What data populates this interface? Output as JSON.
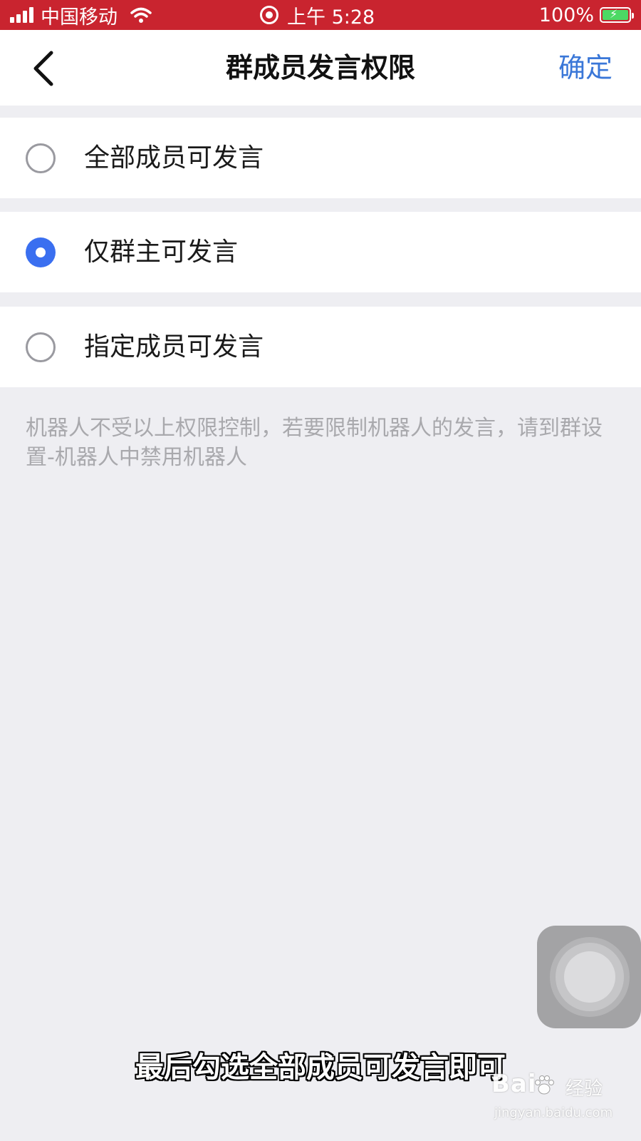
{
  "status_bar": {
    "carrier": "中国移动",
    "time": "上午 5:28",
    "battery": "100%",
    "battery_level": 1.0,
    "colors": {
      "background": "#c9242f",
      "battery": "#4cd964"
    }
  },
  "nav": {
    "title": "群成员发言权限",
    "confirm_label": "确定",
    "confirm_color": "#3a77d8"
  },
  "options": [
    {
      "label": "全部成员可发言",
      "selected": false
    },
    {
      "label": "仅群主可发言",
      "selected": true
    },
    {
      "label": "指定成员可发言",
      "selected": false
    }
  ],
  "note": "机器人不受以上权限控制，若要限制机器人的发言，请到群设置-机器人中禁用机器人",
  "subtitle": "最后勾选全部成员可发言即可",
  "watermark": {
    "brand": "Bai",
    "suffix": "经验",
    "url": "jingyan.baidu.com"
  },
  "accent_color": "#3a6ff0"
}
